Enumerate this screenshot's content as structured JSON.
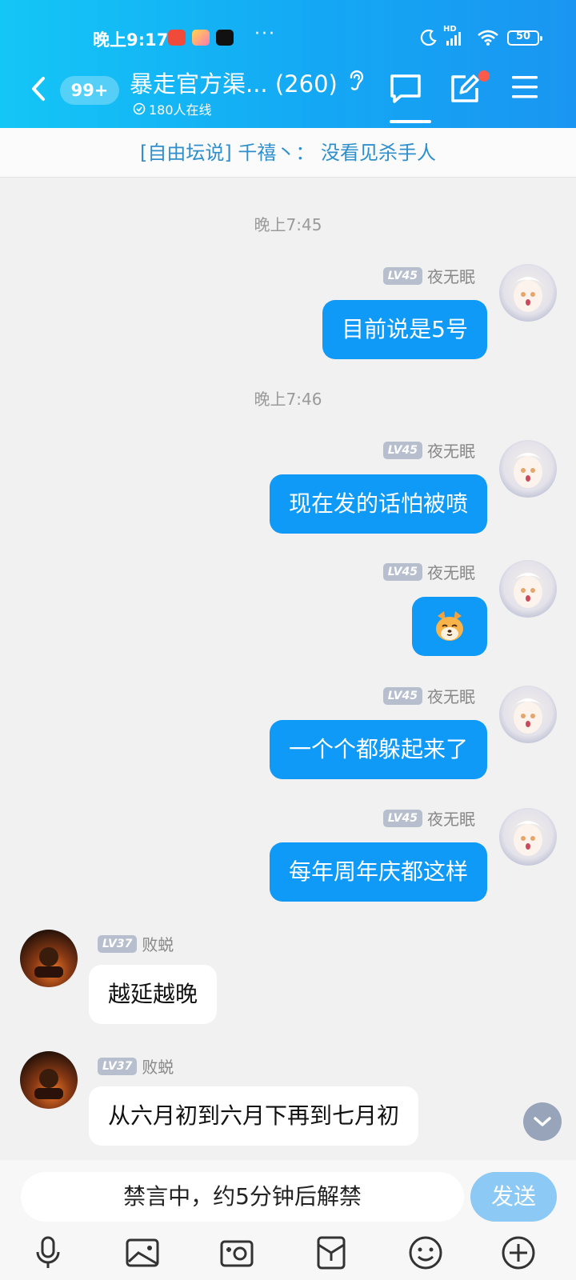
{
  "status_bar": {
    "time": "晚上9:17",
    "more": "···",
    "network": "HD",
    "battery": "50"
  },
  "header": {
    "unread_badge": "99+",
    "title": "暴走官方渠... (260)",
    "online": "180人在线"
  },
  "notice": "[自由坛说] 千禧丶： 没看见杀手人",
  "messages": {
    "ts1": "晚上7:45",
    "m1": {
      "level": "LV45",
      "sender": "夜无眠",
      "text": "目前说是5号"
    },
    "ts2": "晚上7:46",
    "m2": {
      "level": "LV45",
      "sender": "夜无眠",
      "text": "现在发的话怕被喷"
    },
    "m3": {
      "level": "LV45",
      "sender": "夜无眠",
      "sticker": "dog-face-emoji"
    },
    "m4": {
      "level": "LV45",
      "sender": "夜无眠",
      "text": "一个个都躲起来了"
    },
    "m5": {
      "level": "LV45",
      "sender": "夜无眠",
      "text": "每年周年庆都这样"
    },
    "m6": {
      "level": "LV37",
      "sender": "败蜕",
      "text": "越延越晚"
    },
    "m7": {
      "level": "LV37",
      "sender": "败蜕",
      "text": "从六月初到六月下再到七月初"
    }
  },
  "input": {
    "placeholder": "禁言中，约5分钟后解禁",
    "send_label": "发送"
  },
  "colors": {
    "accent": "#0f9af7",
    "header_start": "#14c6f6",
    "header_end": "#1a96f2",
    "notice_text": "#2f8fcc"
  }
}
